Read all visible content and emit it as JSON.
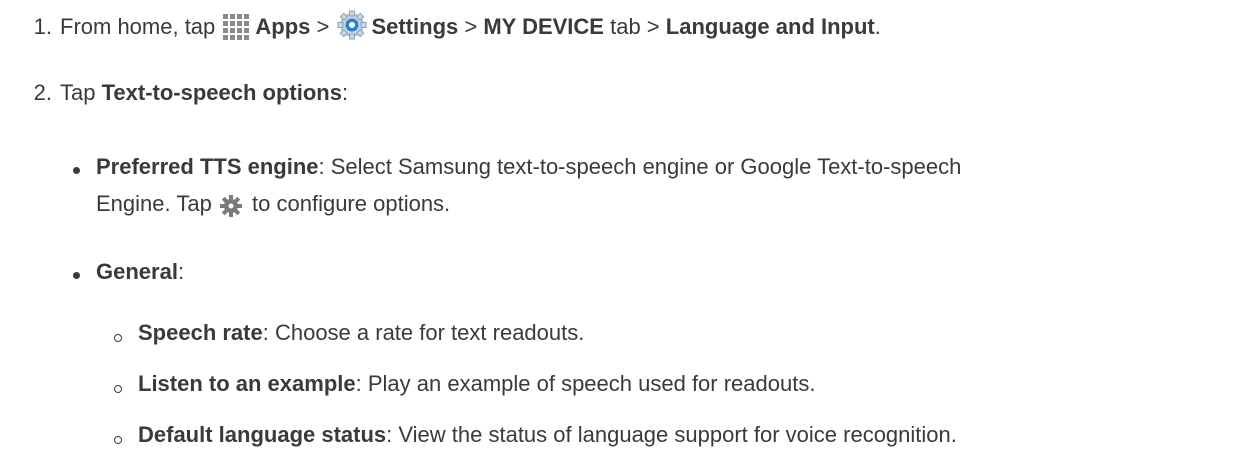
{
  "steps": [
    {
      "number": "1.",
      "text_a": "From home, tap",
      "apps_label": "Apps",
      "sep1": " > ",
      "settings_label": "Settings",
      "sep2": " > ",
      "my_device_label": "MY DEVICE",
      "text_b": " tab > ",
      "language_label": "Language and Input",
      "period": ".",
      "icons": [
        "apps-grid-icon",
        "settings-gear-icon"
      ]
    },
    {
      "number": "2.",
      "text_a": "Tap ",
      "tts_label": "Text-to-speech options",
      "colon": ":"
    }
  ],
  "bullets": [
    {
      "title": "Preferred TTS engine",
      "desc_line1": ": Select Samsung text-to-speech engine or Google Text-to-speech",
      "desc_line2_a": "Engine. Tap ",
      "desc_line2_b": " to configure options.",
      "icon": "cog-icon"
    },
    {
      "title": "General",
      "colon": ":"
    }
  ],
  "sub_bullets": [
    {
      "title": "Speech rate",
      "desc": ": Choose a rate for text readouts."
    },
    {
      "title": "Listen to an example",
      "desc": ": Play an example of speech used for readouts."
    },
    {
      "title": "Default language status",
      "desc": ": View the status of language support for voice recognition."
    }
  ],
  "colors": {
    "text": "#3a3a3a",
    "apps_icon": "#8a8a8a",
    "settings_icon_blue": "#2a7fd4",
    "cog_icon": "#7a7a7a"
  }
}
